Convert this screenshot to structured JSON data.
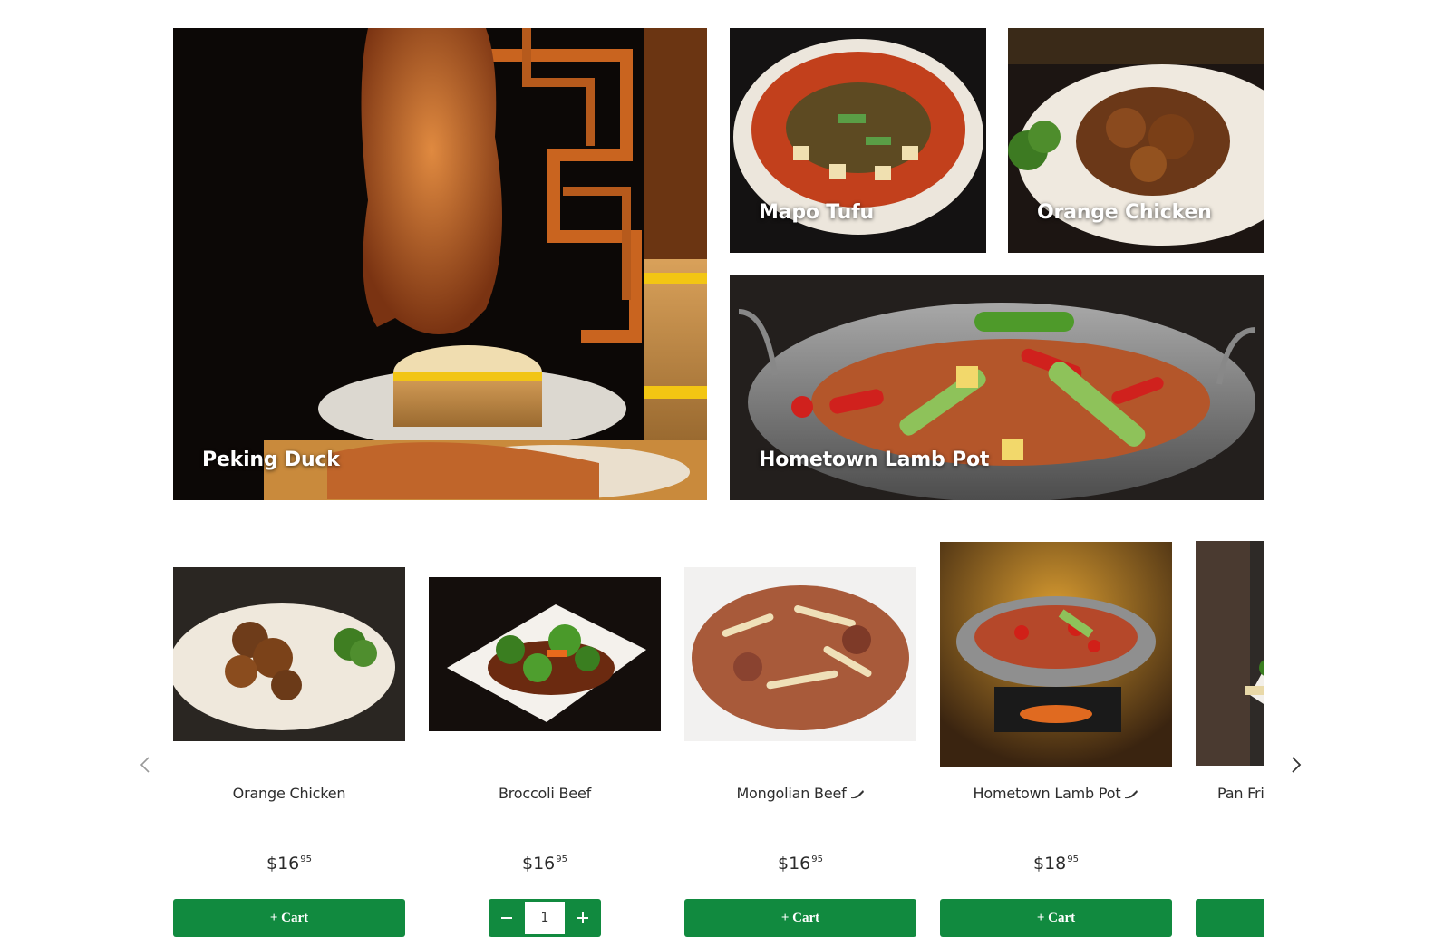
{
  "featured": [
    {
      "id": "peking",
      "label": "Peking Duck"
    },
    {
      "id": "mapo",
      "label": "Mapo Tufu"
    },
    {
      "id": "orange",
      "label": "Orange Chicken"
    },
    {
      "id": "lamb",
      "label": "Hometown Lamb Pot"
    }
  ],
  "carousel": {
    "items": [
      {
        "name": "Orange Chicken",
        "spicy": false,
        "price_dollars": "$16",
        "price_cents": "95",
        "cart_label": "+ Cart"
      },
      {
        "name": "Broccoli Beef",
        "spicy": false,
        "price_dollars": "$16",
        "price_cents": "95",
        "quantity": "1"
      },
      {
        "name": "Mongolian Beef",
        "spicy": true,
        "price_dollars": "$16",
        "price_cents": "95",
        "cart_label": "+ Cart"
      },
      {
        "name": "Hometown Lamb Pot",
        "spicy": true,
        "price_dollars": "$18",
        "price_cents": "95",
        "cart_label": "+ Cart"
      },
      {
        "name": "Pan Frie",
        "spicy": false
      }
    ]
  },
  "colors": {
    "accent": "#118a3f"
  }
}
